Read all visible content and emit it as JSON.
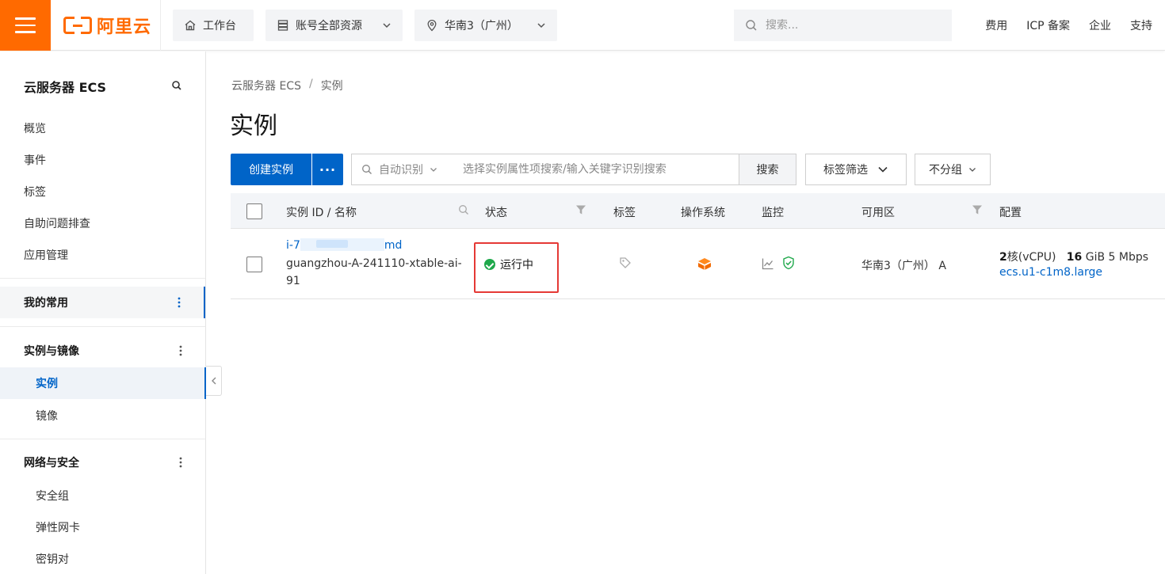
{
  "topbar": {
    "logo_text": "阿里云",
    "workbench": "工作台",
    "resources": "账号全部资源",
    "region": "华南3（广州）",
    "search_placeholder": "搜索...",
    "links": [
      "费用",
      "ICP 备案",
      "企业",
      "支持"
    ]
  },
  "sidebar": {
    "title": "云服务器 ECS",
    "items": [
      "概览",
      "事件",
      "标签",
      "自助问题排查",
      "应用管理"
    ],
    "groups": {
      "common": "我的常用",
      "instances_images": "实例与镜像",
      "network_security": "网络与安全"
    },
    "instances_images_items": [
      "实例",
      "镜像"
    ],
    "network_security_items": [
      "安全组",
      "弹性网卡",
      "密钥对"
    ]
  },
  "breadcrumb": [
    "云服务器 ECS",
    "实例"
  ],
  "page_title": "实例",
  "toolbar": {
    "create_label": "创建实例",
    "more_label": "···",
    "filter_mode": "自动识别",
    "filter_placeholder": "选择实例属性项搜索/输入关键字识别搜索",
    "search_label": "搜索",
    "tag_filter_label": "标签筛选",
    "group_label": "不分组"
  },
  "table": {
    "columns": [
      "实例 ID / 名称",
      "状态",
      "标签",
      "操作系统",
      "监控",
      "可用区",
      "配置"
    ],
    "rows": [
      {
        "id_prefix": "i-7",
        "id_suffix": "md",
        "name": "guangzhou-A-241110-xtable-ai-91",
        "status": "运行中",
        "zone": "华南3（广州） A",
        "cpu_value": "2",
        "cpu_unit": "核(vCPU)",
        "mem_value": "16",
        "mem_unit": "GiB",
        "bandwidth": "5 Mbps",
        "instance_type": "ecs.u1-c1m8.large"
      }
    ]
  },
  "colors": {
    "brand": "#ff6a00",
    "primary": "#0064c8",
    "status_ok": "#1fa84b",
    "highlight": "#e53935"
  }
}
